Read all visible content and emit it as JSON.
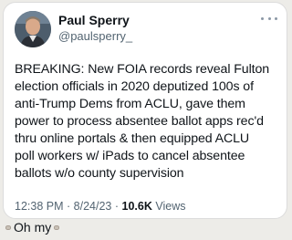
{
  "tweet": {
    "author": {
      "display_name": "Paul Sperry",
      "handle": "@paulsperry_",
      "avatar_icon": "profile-photo"
    },
    "more_icon": "more-dots-icon",
    "text": "BREAKING: New FOIA records reveal Fulton\nelection officials in 2020 deputized 100s of\nanti-Trump Dems from ACLU, gave them\npower to process absentee ballot apps rec'd\nthru online portals & then equipped ACLU\npoll workers w/ iPads to cancel absentee\nballots w/o county supervision",
    "time": "12:38 PM",
    "separator": "·",
    "date": "8/24/23",
    "views_count": "10.6K",
    "views_label": "Views"
  },
  "caption": {
    "text": "Oh my",
    "emoji_icon": "grimace-emoji-icon"
  },
  "colors": {
    "background": "#edece8",
    "card": "#ffffff",
    "secondary_text": "#536471",
    "primary_text": "#0f1419"
  }
}
